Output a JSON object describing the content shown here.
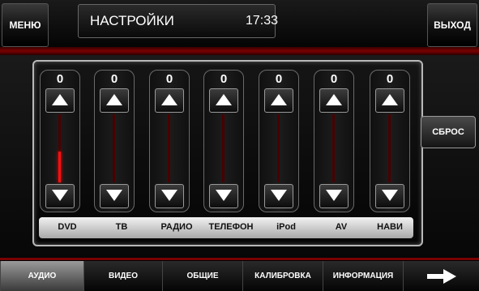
{
  "header": {
    "menu_label": "МЕНЮ",
    "title": "НАСТРОЙКИ",
    "clock": "17:33",
    "exit_label": "ВЫХОД"
  },
  "equalizer": {
    "channels": [
      {
        "label": "DVD",
        "value": "0",
        "level": 0.45
      },
      {
        "label": "ТВ",
        "value": "0",
        "level": 0.0
      },
      {
        "label": "РАДИО",
        "value": "0",
        "level": 0.0
      },
      {
        "label": "ТЕЛЕФОН",
        "value": "0",
        "level": 0.0
      },
      {
        "label": "iPod",
        "value": "0",
        "level": 0.0
      },
      {
        "label": "AV",
        "value": "0",
        "level": 0.0
      },
      {
        "label": "НАВИ",
        "value": "0",
        "level": 0.0
      }
    ],
    "reset_label": "СБРОС"
  },
  "tabs": [
    {
      "label": "АУДИО",
      "active": true
    },
    {
      "label": "ВИДЕО",
      "active": false
    },
    {
      "label": "ОБЩИЕ",
      "active": false
    },
    {
      "label": "КАЛИБРОВКА",
      "active": false
    },
    {
      "label": "ИНФОРМАЦИЯ",
      "active": false
    }
  ],
  "icons": {
    "next": "arrow-right-icon",
    "up": "triangle-up-icon",
    "down": "triangle-down-icon"
  },
  "colors": {
    "accent": "#ff1010",
    "band": "#7a0000"
  }
}
